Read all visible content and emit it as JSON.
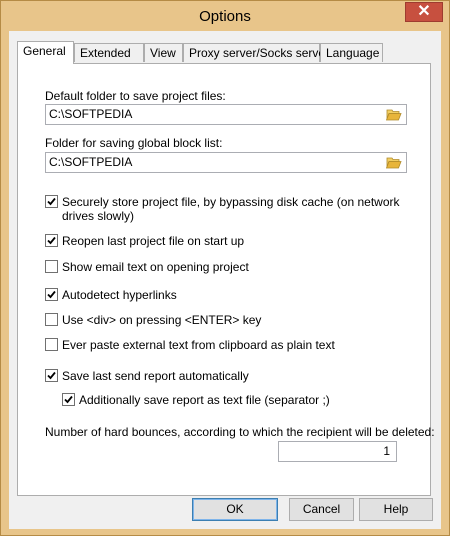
{
  "window": {
    "title": "Options",
    "close_glyph": "✕"
  },
  "tabs": [
    {
      "label": "General",
      "active": true
    },
    {
      "label": "Extended",
      "active": false
    },
    {
      "label": "View",
      "active": false
    },
    {
      "label": "Proxy server/Socks server",
      "active": false
    },
    {
      "label": "Language",
      "active": false
    }
  ],
  "general": {
    "default_folder_label": "Default folder to save project files:",
    "default_folder_value": "C:\\SOFTPEDIA",
    "blocklist_folder_label": "Folder for saving global block list:",
    "blocklist_folder_value": "C:\\SOFTPEDIA",
    "options": [
      {
        "label": "Securely store project file, by bypassing disk cache (on network drives slowly)",
        "checked": true
      },
      {
        "label": "Reopen last project file on start up",
        "checked": true
      },
      {
        "label": "Show email text on opening project",
        "checked": false
      },
      {
        "label": "Autodetect hyperlinks",
        "checked": true
      },
      {
        "label": "Use <div> on pressing <ENTER> key",
        "checked": false
      },
      {
        "label": "Ever paste external text from clipboard as plain text",
        "checked": false
      },
      {
        "label": "Save last send report automatically",
        "checked": true
      },
      {
        "label": "Additionally save report as text file (separator ;)",
        "checked": true
      }
    ],
    "bounces_label": "Number of hard bounces, according to which the recipient will be deleted:",
    "bounces_value": "1"
  },
  "buttons": {
    "ok": "OK",
    "cancel": "Cancel",
    "help": "Help"
  },
  "colors": {
    "titlebar": "#e8c58a",
    "close": "#c7503f",
    "folder_icon": "#e8b53a"
  },
  "icons": {
    "folder": "folder-open-icon",
    "check": "check-icon"
  }
}
